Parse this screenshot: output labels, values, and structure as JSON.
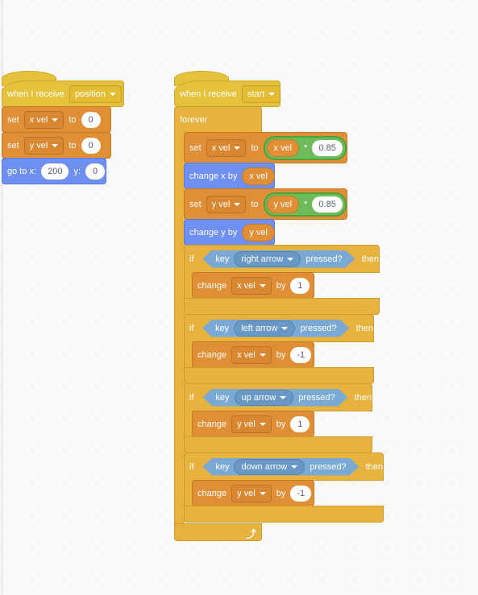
{
  "colors": {
    "events": "#e6c23c",
    "control": "#e8b23f",
    "variables": "#e08f37",
    "motion": "#6f8ff2",
    "operators": "#6dbb5a",
    "sensing": "#7aa9d6"
  },
  "script1": {
    "hat": {
      "label": "when I receive",
      "message": "position"
    },
    "set1": {
      "label": "set",
      "var": "x vel",
      "to": "to",
      "value": "0"
    },
    "set2": {
      "label": "set",
      "var": "y vel",
      "to": "to",
      "value": "0"
    },
    "goto": {
      "label": "go to x:",
      "x": "200",
      "ylabel": "y:",
      "y": "0"
    }
  },
  "script2": {
    "hat": {
      "label": "when I receive",
      "message": "start"
    },
    "forever": {
      "label": "forever",
      "loop_icon": "loop-arrow-icon"
    },
    "setx": {
      "label": "set",
      "var": "x vel",
      "to": "to",
      "op_left": "x vel",
      "op": "*",
      "op_right": "0.85"
    },
    "changex": {
      "label": "change x by",
      "value": "x vel"
    },
    "sety": {
      "label": "set",
      "var": "y vel",
      "to": "to",
      "op_left": "y vel",
      "op": "*",
      "op_right": "0.85"
    },
    "changey": {
      "label": "change y by",
      "value": "y vel"
    },
    "ifs": [
      {
        "if": "if",
        "key": "key",
        "option": "right arrow",
        "pressed": "pressed?",
        "then": "then",
        "change": "change",
        "var": "x vel",
        "by": "by",
        "value": "1"
      },
      {
        "if": "if",
        "key": "key",
        "option": "left arrow",
        "pressed": "pressed?",
        "then": "then",
        "change": "change",
        "var": "x vel",
        "by": "by",
        "value": "-1"
      },
      {
        "if": "if",
        "key": "key",
        "option": "up arrow",
        "pressed": "pressed?",
        "then": "then",
        "change": "change",
        "var": "y vel",
        "by": "by",
        "value": "1"
      },
      {
        "if": "if",
        "key": "key",
        "option": "down arrow",
        "pressed": "pressed?",
        "then": "then",
        "change": "change",
        "var": "y vel",
        "by": "by",
        "value": "-1"
      }
    ]
  }
}
